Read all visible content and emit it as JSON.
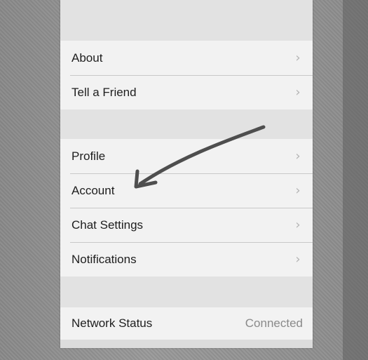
{
  "menu": {
    "group1": [
      {
        "label": "About",
        "icon": "chevron-right-icon"
      },
      {
        "label": "Tell a Friend",
        "icon": "chevron-right-icon"
      }
    ],
    "group2": [
      {
        "label": "Profile",
        "icon": "chevron-right-icon"
      },
      {
        "label": "Account",
        "icon": "chevron-right-icon"
      },
      {
        "label": "Chat Settings",
        "icon": "chevron-right-icon"
      },
      {
        "label": "Notifications",
        "icon": "chevron-right-icon"
      }
    ],
    "group3": [
      {
        "label": "Network Status",
        "value": "Connected"
      }
    ]
  },
  "annotation": {
    "type": "hand-drawn arrow",
    "points_to": "Account",
    "color": "#505050"
  },
  "colors": {
    "row_background": "#f2f2f2",
    "group_gap": "#e2e2e2",
    "text": "#1e1e1e",
    "secondary_text": "#8a8a8a",
    "chevron": "#b4b4b4"
  }
}
